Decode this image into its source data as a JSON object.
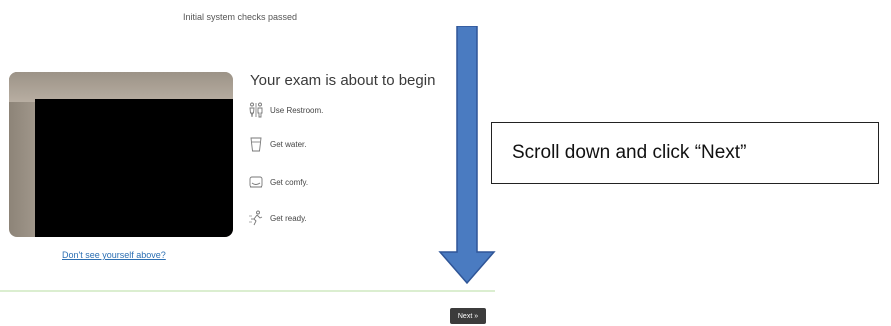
{
  "status_text": "Initial system checks passed",
  "camera": {
    "link_text": "Don't see yourself above?"
  },
  "title": "Your exam is about to begin",
  "steps": [
    {
      "label": "Use Restroom.",
      "icon": "restroom-icon"
    },
    {
      "label": "Get water.",
      "icon": "water-glass-icon"
    },
    {
      "label": "Get comfy.",
      "icon": "armchair-icon"
    },
    {
      "label": "Get ready.",
      "icon": "running-person-icon"
    }
  ],
  "next_label": "Next »",
  "annotation": {
    "callout_text": "Scroll down and click “Next”",
    "arrow_color": "#4a7bc1"
  },
  "colors": {
    "link": "#2c6fb3",
    "divider": "#dbeed0",
    "next_button": "#3c3c3c"
  }
}
